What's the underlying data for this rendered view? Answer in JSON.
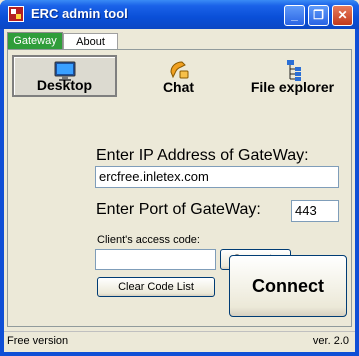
{
  "window": {
    "title": "ERC admin tool",
    "minimize": "_",
    "restore": "❐",
    "close": "✕"
  },
  "tabs": [
    {
      "label": "Gateway"
    },
    {
      "label": "About"
    }
  ],
  "modes": [
    {
      "label": "Desktop",
      "icon": "monitor-icon"
    },
    {
      "label": "Chat",
      "icon": "phone-icon"
    },
    {
      "label": "File explorer",
      "icon": "tree-icon"
    }
  ],
  "form": {
    "ip_label": "Enter IP Address of GateWay:",
    "ip_value": "ercfree.inletex.com",
    "port_label": "Enter Port of GateWay:",
    "port_value": "443",
    "code_label": "Client's access code:",
    "code_value": "",
    "generate_label": "Generate",
    "clear_label": "Clear Code List",
    "connect_label": "Connect"
  },
  "status": {
    "left": "Free version",
    "right": "ver. 2.0"
  },
  "colors": {
    "titlebar": "#0a4fd8",
    "active_tab": "#2f9d3a"
  }
}
